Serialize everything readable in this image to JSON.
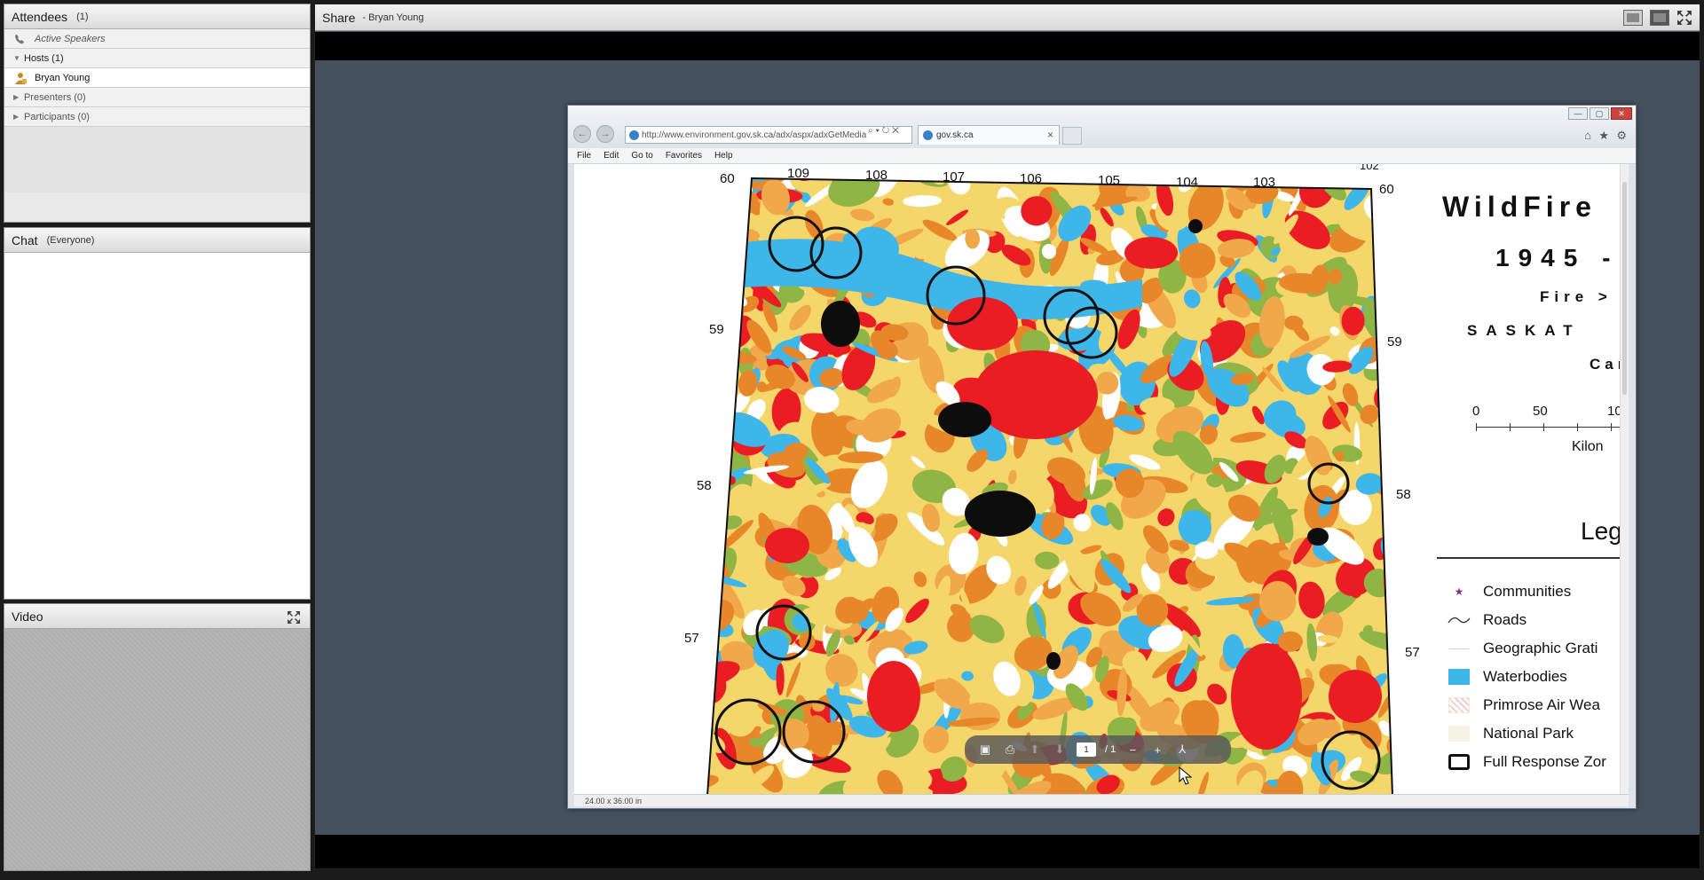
{
  "attendees": {
    "title": "Attendees",
    "count": "(1)",
    "active_speakers": "Active Speakers",
    "hosts_label": "Hosts (1)",
    "host_name": "Bryan Young",
    "presenters_label": "Presenters (0)",
    "participants_label": "Participants (0)"
  },
  "chat": {
    "title": "Chat",
    "scope": "(Everyone)"
  },
  "video": {
    "title": "Video"
  },
  "share": {
    "title": "Share",
    "presenter": "- Bryan Young"
  },
  "browser": {
    "url": "http://www.environment.gov.sk.ca/adx/aspx/adxGetMedia",
    "tab_title": "gov.sk.ca",
    "menu": [
      "File",
      "Edit",
      "Go to",
      "Favorites",
      "Help"
    ],
    "status_text": "24.00 x 36.00 in"
  },
  "map": {
    "top_longitudes": [
      "109",
      "108",
      "107",
      "106",
      "105",
      "104",
      "103",
      "102"
    ],
    "left_latitudes": [
      "60",
      "59",
      "58",
      "57"
    ],
    "right_latitudes": [
      "60",
      "59",
      "58",
      "57"
    ],
    "legend": {
      "title": "WildFire",
      "years": "1945 -",
      "subtitle1": "Fire >",
      "subtitle2": "SASKAT",
      "subtitle3": "Can",
      "scale_labels": [
        "0",
        "50",
        "10"
      ],
      "units": "Kilon",
      "heading": "Leg",
      "items": [
        "Communities",
        "Roads",
        "Geographic Grati",
        "Waterbodies",
        "Primrose Air Wea",
        "National Park",
        "Full Response Zor"
      ]
    }
  },
  "pdf_toolbar": {
    "page": "1",
    "total": "/ 1"
  },
  "colors": {
    "share_bg": "#45525e",
    "fire_red": "#ea1c24",
    "fire_orange": "#e8872a",
    "fire_yellow": "#f5d66a",
    "fire_green": "#8fb545",
    "water_blue": "#3fb6ea",
    "burn_black": "#0d0d0d"
  }
}
